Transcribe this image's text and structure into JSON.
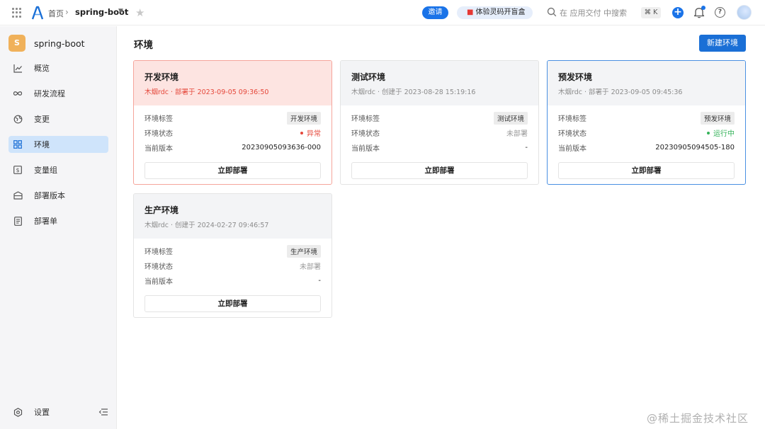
{
  "topbar": {
    "home": "首页",
    "project": "spring-boot",
    "invite": "邀请",
    "trial": "体验灵码开盲盒",
    "search_placeholder": "在 应用交付 中搜索",
    "shortcut": "⌘ K",
    "help": "?"
  },
  "sidebar": {
    "project_initial": "S",
    "project_name": "spring-boot",
    "items": [
      {
        "label": "概览"
      },
      {
        "label": "研发流程"
      },
      {
        "label": "变更"
      },
      {
        "label": "环境"
      },
      {
        "label": "变量组"
      },
      {
        "label": "部署版本"
      },
      {
        "label": "部署单"
      }
    ],
    "settings": "设置"
  },
  "main": {
    "title": "环境",
    "new_button": "新建环境",
    "field_labels": {
      "tag": "环境标签",
      "status": "环境状态",
      "version": "当前版本"
    },
    "cards": [
      {
        "title": "开发环境",
        "subtitle": "木烟rdc · 部署于 2023-09-05 09:36:50",
        "tag": "开发环境",
        "status": "异常",
        "version": "20230905093636-000",
        "action": "立即部署"
      },
      {
        "title": "测试环境",
        "subtitle": "木烟rdc · 创建于 2023-08-28 15:19:16",
        "tag": "测试环境",
        "status": "未部署",
        "version": "-",
        "action": "立即部署"
      },
      {
        "title": "预发环境",
        "subtitle": "木烟rdc · 部署于 2023-09-05 09:45:36",
        "tag": "预发环境",
        "status": "运行中",
        "version": "20230905094505-180",
        "action": "立即部署"
      },
      {
        "title": "生产环境",
        "subtitle": "木烟rdc · 创建于 2024-02-27 09:46:57",
        "tag": "生产环境",
        "status": "未部署",
        "version": "-",
        "action": "立即部署"
      }
    ]
  },
  "watermark": "@稀土掘金技术社区",
  "colors": {
    "primary": "#1a6fd6",
    "error": "#e5483b",
    "success": "#35b35a",
    "active_nav": "#cfe4fb"
  }
}
